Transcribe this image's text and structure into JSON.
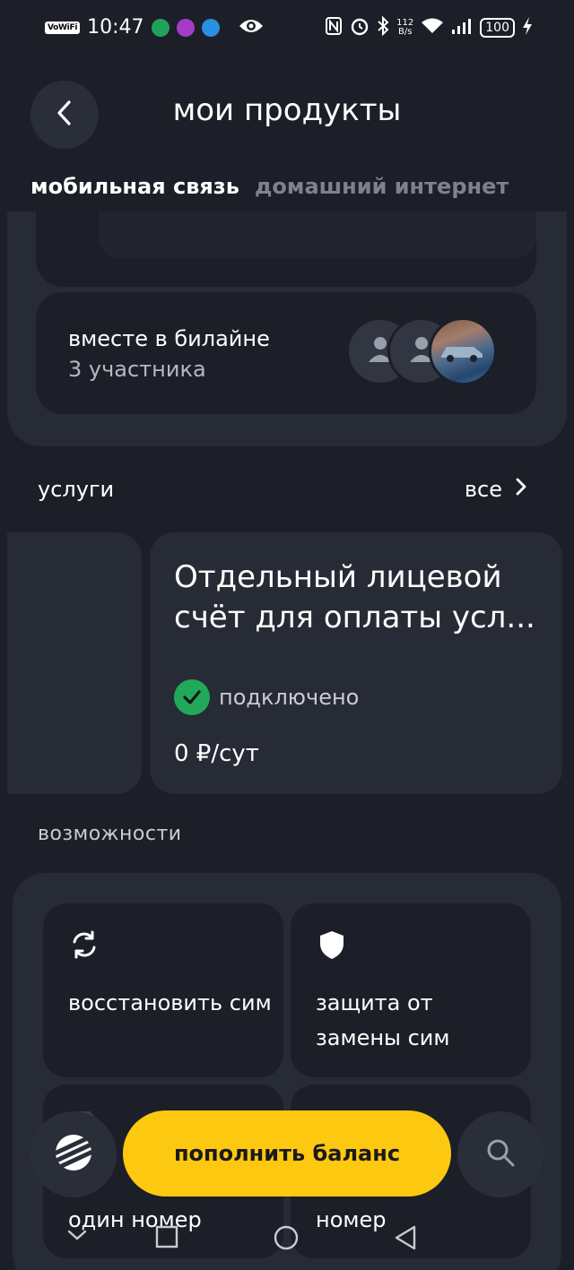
{
  "status_bar": {
    "vowifi": "VoWiFi",
    "time": "10:47",
    "net_speed_value": "112",
    "net_speed_unit": "B/s",
    "battery": "100"
  },
  "header": {
    "title": "мои продукты",
    "back_icon": "chevron-left-icon"
  },
  "tabs": [
    {
      "label": "мобильная связь",
      "active": true
    },
    {
      "label": "домашний интернет",
      "active": false
    }
  ],
  "together": {
    "title": "вместе в билайне",
    "subtitle": "3 участника"
  },
  "services": {
    "title": "услуги",
    "all_label": "все",
    "card": {
      "name": "Отдельный лицевой счёт для оплаты усл...",
      "status": "подключено",
      "price": "0 ₽/сут"
    }
  },
  "features": {
    "title": "возможности",
    "items": [
      {
        "label": "восстановить сим",
        "icon": "refresh-icon"
      },
      {
        "label": "защита от замены сим",
        "icon": "shield-icon"
      },
      {
        "label": "один номер",
        "icon": "sim-icon"
      },
      {
        "label": "номер",
        "icon": "number-icon"
      }
    ]
  },
  "bottom_bar": {
    "topup_label": "пополнить баланс",
    "logo_icon": "beeline-logo-icon",
    "search_icon": "search-icon"
  },
  "colors": {
    "background": "#1c1f27",
    "card": "#272b35",
    "accent_yellow": "#fdc810",
    "status_green": "#22a85a"
  }
}
